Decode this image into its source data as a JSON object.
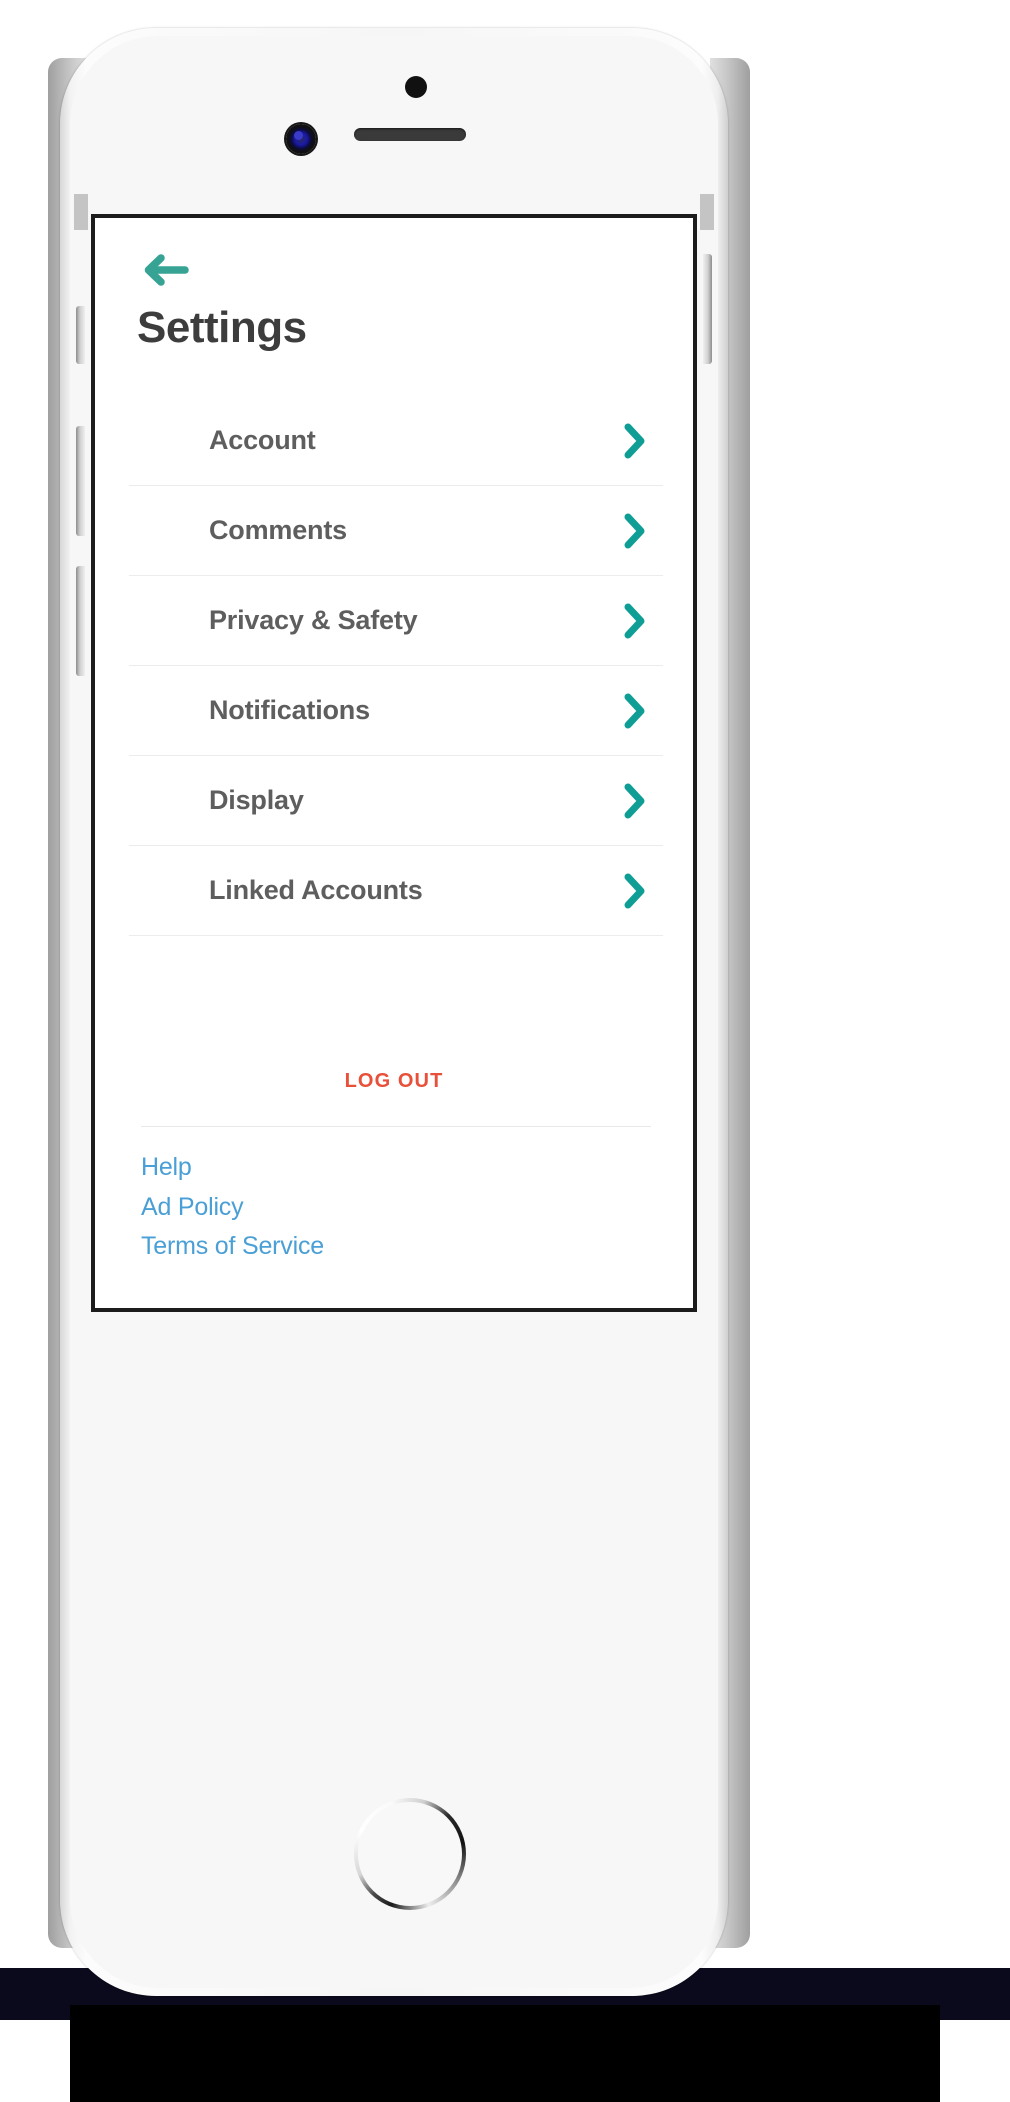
{
  "device": {
    "type": "smartphone-mockup",
    "hardware": {
      "sensor_dot": "proximity-sensor",
      "camera": "front-camera",
      "speaker": "earpiece-speaker",
      "home_button": "home-button",
      "buttons": [
        "mute-switch",
        "volume-up",
        "volume-down",
        "power-button"
      ]
    }
  },
  "colors": {
    "accent_teal": "#0f9e96",
    "back_arrow_teal": "#36a394",
    "title_gray": "#3d3d3d",
    "label_gray": "#5e5e5e",
    "logout_red": "#e8503a",
    "link_blue": "#4a9fd6",
    "divider": "#ececec",
    "screen_bg": "#ffffff"
  },
  "screen": {
    "back_button": {
      "icon": "arrow-left-icon",
      "label": "Back"
    },
    "title": "Settings",
    "menu": {
      "items": [
        {
          "label": "Account",
          "chevron": "chevron-right-icon"
        },
        {
          "label": "Comments",
          "chevron": "chevron-right-icon"
        },
        {
          "label": "Privacy & Safety",
          "chevron": "chevron-right-icon"
        },
        {
          "label": "Notifications",
          "chevron": "chevron-right-icon"
        },
        {
          "label": "Display",
          "chevron": "chevron-right-icon"
        },
        {
          "label": "Linked Accounts",
          "chevron": "chevron-right-icon"
        }
      ]
    },
    "logout": {
      "label": "LOG OUT"
    },
    "footer": {
      "links": [
        {
          "label": "Help"
        },
        {
          "label": "Ad Policy"
        },
        {
          "label": "Terms of Service"
        }
      ]
    }
  }
}
